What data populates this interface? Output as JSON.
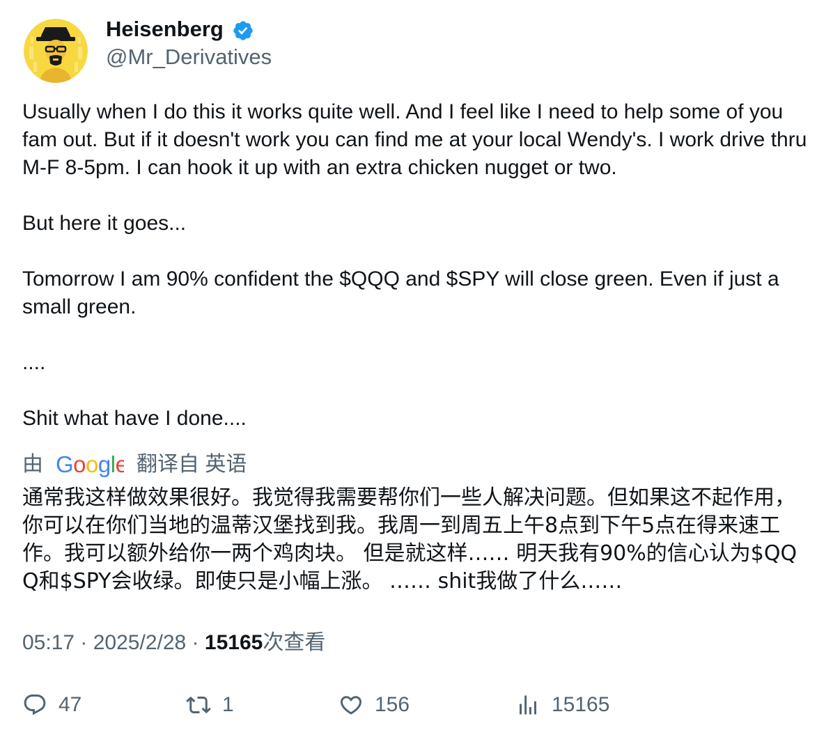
{
  "author": {
    "display_name": "Heisenberg",
    "handle": "@Mr_Derivatives",
    "avatar_icon": "avatar-heisenberg-icon",
    "verified_icon": "verified-badge-icon",
    "verified_color": "#1d9bf0"
  },
  "tweet": {
    "text": "Usually when I do this it works quite well. And I feel like I need to help some of you fam out. But if it doesn't work you can find me at your local Wendy's. I work drive thru M-F 8-5pm. I can hook it up with an extra chicken nugget or two.\n\nBut here it goes...\n\nTomorrow I am 90% confident the $QQQ and $SPY will close green. Even if just a small green.\n\n....\n\nShit what have I done...."
  },
  "translation": {
    "prefix": "由",
    "provider_logo": "google-logo",
    "provider_word": "Google",
    "suffix": "翻译自 英语",
    "text": "通常我这样做效果很好。我觉得我需要帮你们一些人解决问题。但如果这不起作用，你可以在你们当地的温蒂汉堡找到我。我周一到周五上午8点到下午5点在得来速工作。我可以额外给你一两个鸡肉块。 但是就这样…… 明天我有90%的信心认为$QQQ和$SPY会收绿。即使只是小幅上涨。 …… shit我做了什么……"
  },
  "meta": {
    "time": "05:17",
    "sep1": " · ",
    "date": "2025/2/28",
    "sep2": " · ",
    "views_count": "15165",
    "views_label": "次查看"
  },
  "actions": {
    "replies": "47",
    "reposts": "1",
    "likes": "156",
    "views": "15165",
    "icon_color": "#536471"
  },
  "colors": {
    "text_primary": "#0f1419",
    "text_secondary": "#536471",
    "accent": "#1d9bf0"
  }
}
